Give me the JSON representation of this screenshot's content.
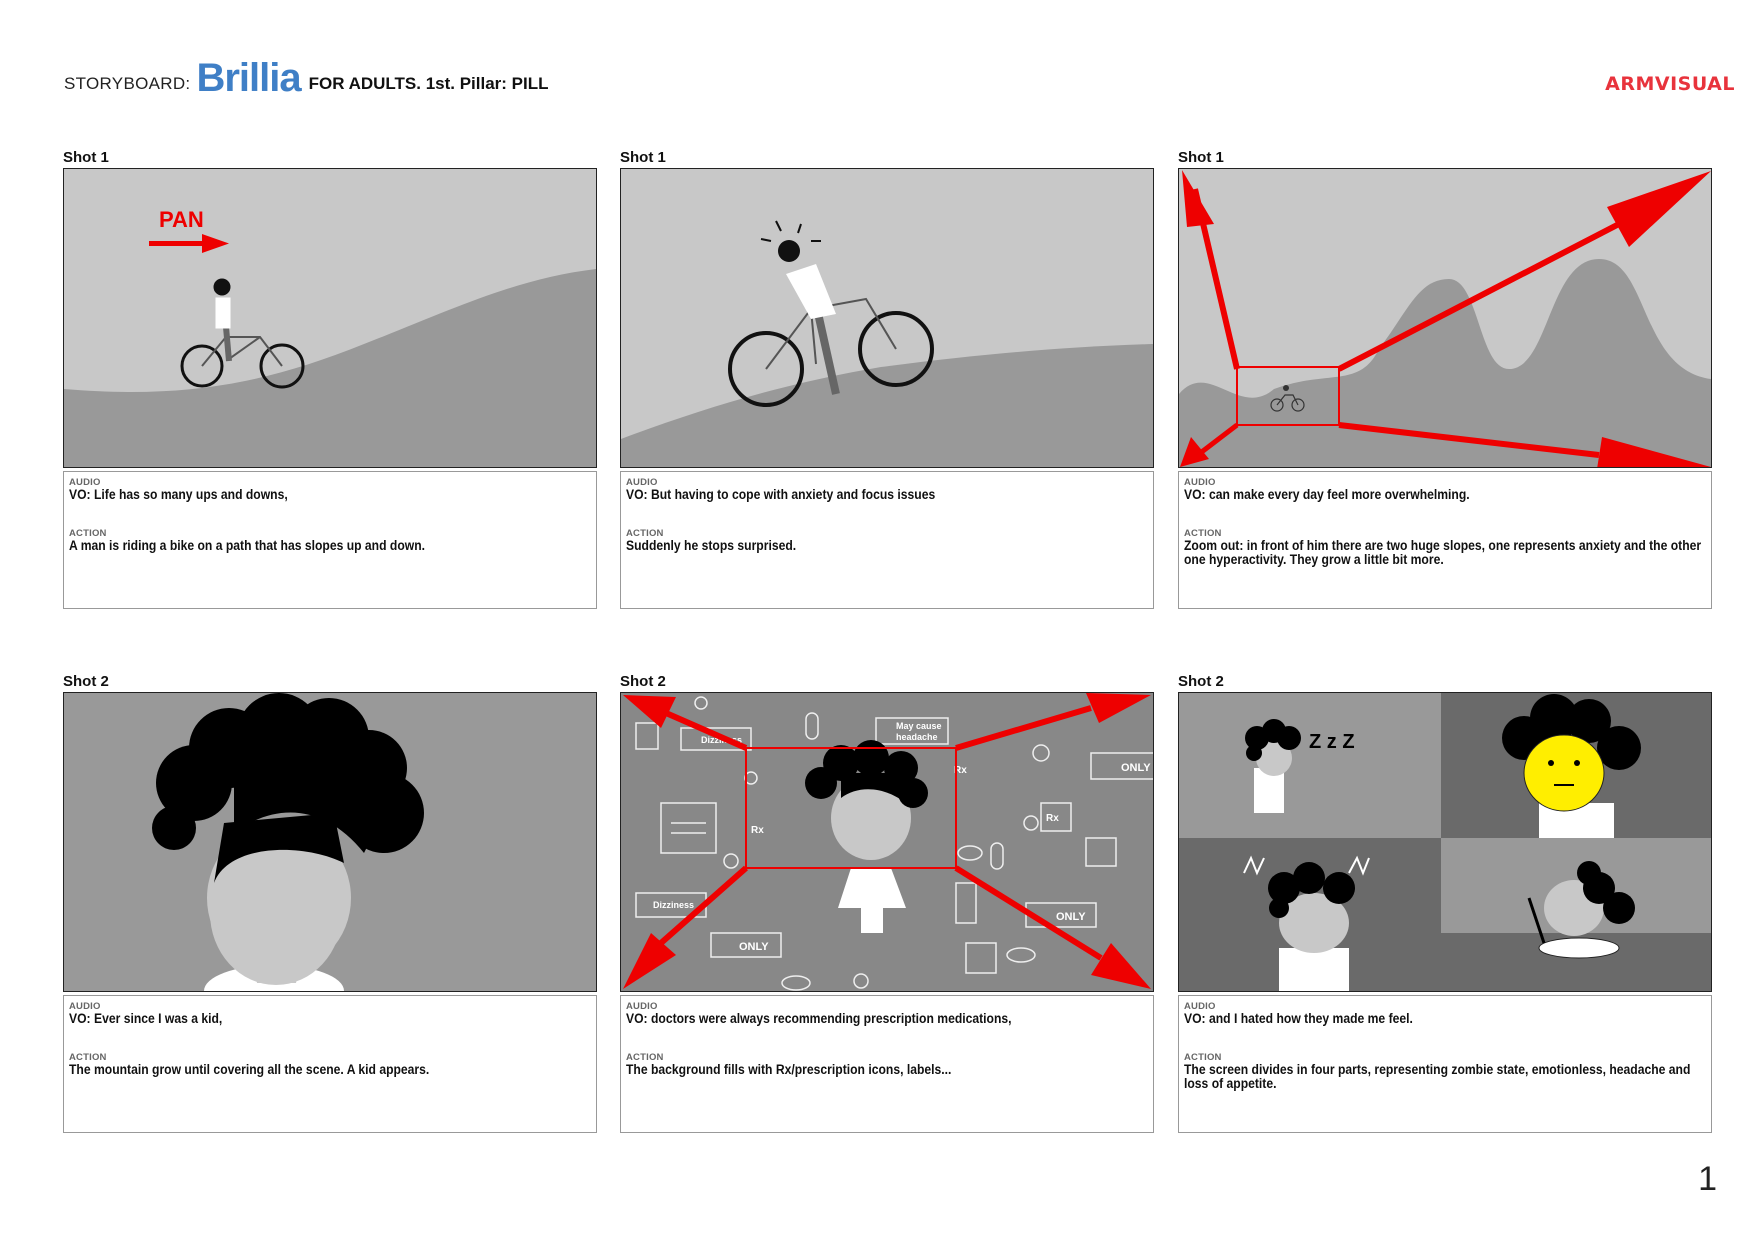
{
  "header": {
    "prefix": "STORYBOARD:",
    "brand": "Brillia",
    "subtitle": "FOR ADULTS. 1st. Pillar: PILL",
    "studio": "ARMVISUAL",
    "page_number": "1"
  },
  "labels": {
    "audio": "AUDIO",
    "action": "ACTION"
  },
  "colors": {
    "brand": "#3f7fc6",
    "arrow": "#ee0000",
    "studio": "#e8333c"
  },
  "panels": [
    {
      "shot": "Shot 1",
      "audio": "VO: Life has so many ups and downs,",
      "action": "A man is riding a bike on a path that has slopes up and down.",
      "overlay_text": "PAN"
    },
    {
      "shot": "Shot 1",
      "audio": "VO: But having to cope with anxiety and focus issues",
      "action": "Suddenly he stops surprised."
    },
    {
      "shot": "Shot 1",
      "audio": "VO: can make every day feel more overwhelming.",
      "action": "Zoom out: in front of him there are two huge slopes, one represents anxiety and the other one hyperactivity. They grow a little bit more."
    },
    {
      "shot": "Shot 2",
      "audio": "VO: Ever since I was a kid,",
      "action": "The mountain grow until covering all the scene. A kid appears."
    },
    {
      "shot": "Shot 2",
      "audio": "VO: doctors were always recommending prescription medications,",
      "action": "The background fills with Rx/prescription icons, labels...",
      "labels_in_art": {
        "dizziness": "Dizziness",
        "may_cause": "May cause",
        "headache": "headache",
        "only": "ONLY",
        "rx": "Rx"
      }
    },
    {
      "shot": "Shot 2",
      "audio": "VO: and I hated how they made me feel.",
      "action": "The screen divides in four parts, representing zombie state, emotionless, headache and loss of appetite.",
      "zzz": "Z z Z"
    }
  ]
}
